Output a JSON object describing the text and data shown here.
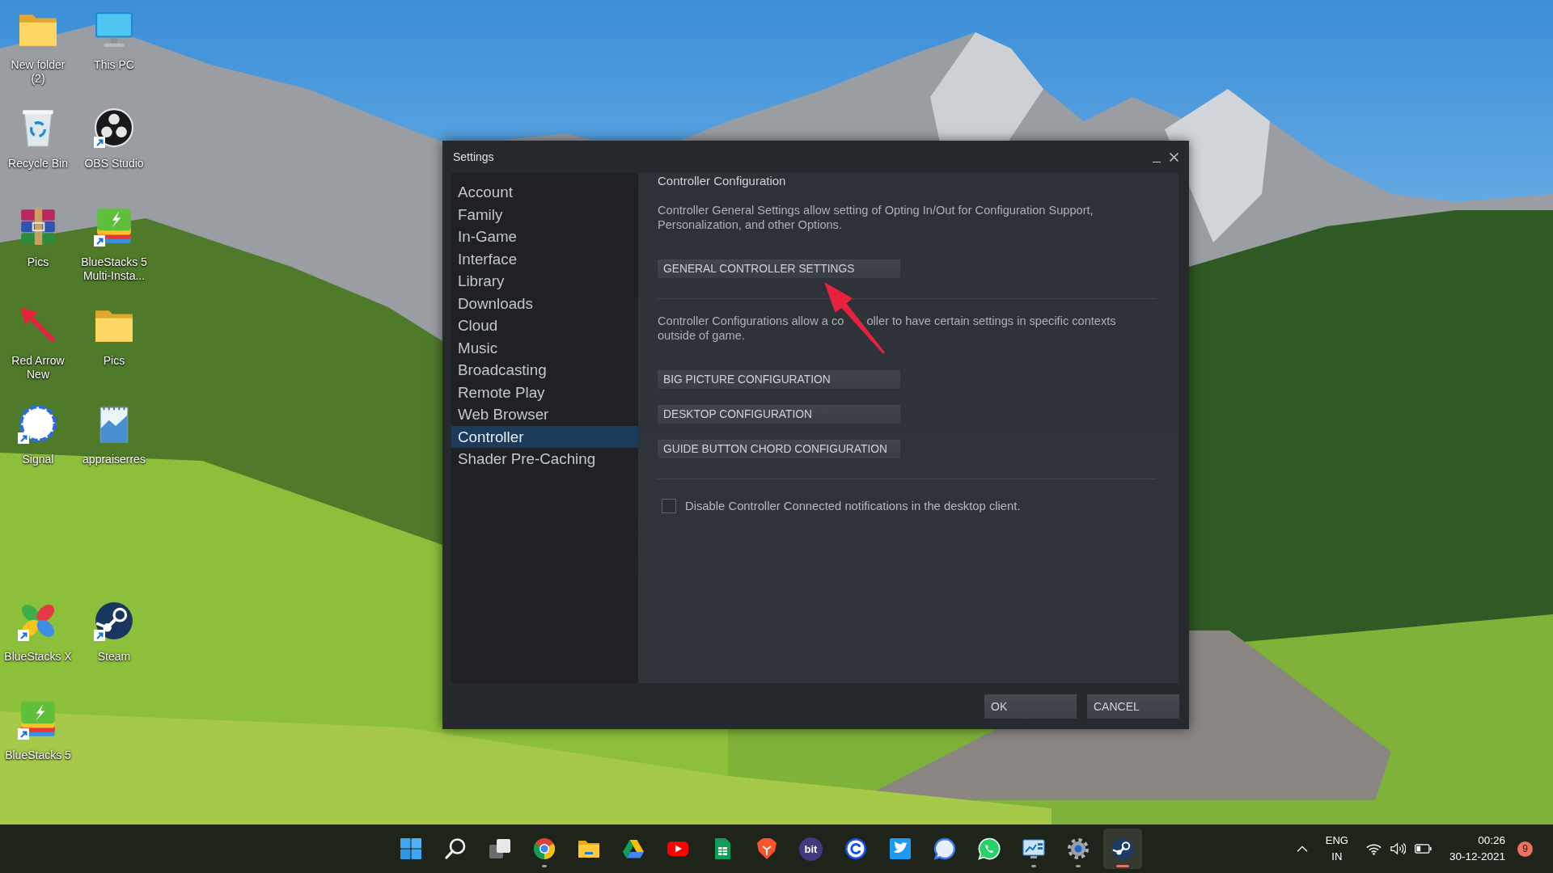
{
  "desktop": {
    "icon_groups": [
      {
        "icons": [
          {
            "label": "New folder (2)",
            "kind": "folder",
            "shortcut": false
          },
          {
            "label": "This PC",
            "kind": "monitor",
            "shortcut": false
          },
          {
            "label": "Recycle Bin",
            "kind": "recycle-bin",
            "shortcut": false
          },
          {
            "label": "OBS Studio",
            "kind": "obs",
            "shortcut": true
          },
          {
            "label": "Pics",
            "kind": "archive",
            "shortcut": false
          },
          {
            "label": "BlueStacks 5 Multi-Insta...",
            "kind": "tiles",
            "shortcut": true
          },
          {
            "label": "Red Arrow New",
            "kind": "arrow",
            "shortcut": false
          },
          {
            "label": "Pics",
            "kind": "folder",
            "shortcut": false
          },
          {
            "label": "Signal",
            "kind": "ring",
            "shortcut": true
          },
          {
            "label": "appraiserres",
            "kind": "notepad",
            "shortcut": false
          }
        ]
      },
      {
        "icons": [
          {
            "label": "BlueStacks X",
            "kind": "petals",
            "shortcut": true
          },
          {
            "label": "Steam",
            "kind": "steam",
            "shortcut": true
          },
          {
            "label": "BlueStacks 5",
            "kind": "tiles",
            "shortcut": true
          }
        ]
      }
    ]
  },
  "window": {
    "title": "Settings",
    "sidebar": {
      "items": [
        {
          "label": "Account",
          "selected": false
        },
        {
          "label": "Family",
          "selected": false
        },
        {
          "label": "In-Game",
          "selected": false
        },
        {
          "label": "Interface",
          "selected": false
        },
        {
          "label": "Library",
          "selected": false
        },
        {
          "label": "Downloads",
          "selected": false
        },
        {
          "label": "Cloud",
          "selected": false
        },
        {
          "label": "Music",
          "selected": false
        },
        {
          "label": "Broadcasting",
          "selected": false
        },
        {
          "label": "Remote Play",
          "selected": false
        },
        {
          "label": "Web Browser",
          "selected": false
        },
        {
          "label": "Controller",
          "selected": true
        },
        {
          "label": "Shader Pre-Caching",
          "selected": false
        }
      ]
    },
    "content": {
      "heading": "Controller Configuration",
      "sections": [
        {
          "description_parts": [
            "Controller General Settings allow setting of Opting In/Out for Configuration Support, Personalization, and other Options."
          ],
          "buttons": [
            "GENERAL CONTROLLER SETTINGS"
          ]
        },
        {
          "description_parts": [
            "Controller Configurations allow a co",
            "oller to have certain settings in specific contexts outside of game."
          ],
          "buttons": [
            "BIG PICTURE CONFIGURATION",
            "DESKTOP CONFIGURATION",
            "GUIDE BUTTON CHORD CONFIGURATION"
          ]
        }
      ],
      "checkbox": {
        "label": "Disable Controller Connected notifications in the desktop client.",
        "checked": false
      }
    },
    "buttons": [
      "OK",
      "CANCEL"
    ]
  },
  "taskbar": {
    "apps": [
      {
        "kind": "start",
        "running": false,
        "selected": false
      },
      {
        "kind": "search",
        "running": false,
        "selected": false
      },
      {
        "kind": "task-view",
        "running": false,
        "selected": false
      },
      {
        "kind": "chrome",
        "running": true,
        "selected": false
      },
      {
        "kind": "explorer",
        "running": false,
        "selected": false
      },
      {
        "kind": "drive",
        "running": false,
        "selected": false
      },
      {
        "kind": "youtube",
        "running": false,
        "selected": false
      },
      {
        "kind": "sheets",
        "running": false,
        "selected": false
      },
      {
        "kind": "brave",
        "running": false,
        "selected": false
      },
      {
        "kind": "text-logo",
        "label": "bit",
        "running": false,
        "selected": false
      },
      {
        "kind": "ring",
        "running": false,
        "selected": false
      },
      {
        "kind": "twitter",
        "running": false,
        "selected": false
      },
      {
        "kind": "signal",
        "running": false,
        "selected": false
      },
      {
        "kind": "whatsapp",
        "running": false,
        "selected": false
      },
      {
        "kind": "monitor",
        "running": true,
        "selected": false
      },
      {
        "kind": "settings",
        "running": true,
        "selected": false
      },
      {
        "kind": "steam",
        "running": true,
        "selected": true
      }
    ],
    "tray": {
      "language": "ENG",
      "region": "IN",
      "time": "00:26",
      "date": "30-12-2021",
      "notifications": "9"
    }
  }
}
